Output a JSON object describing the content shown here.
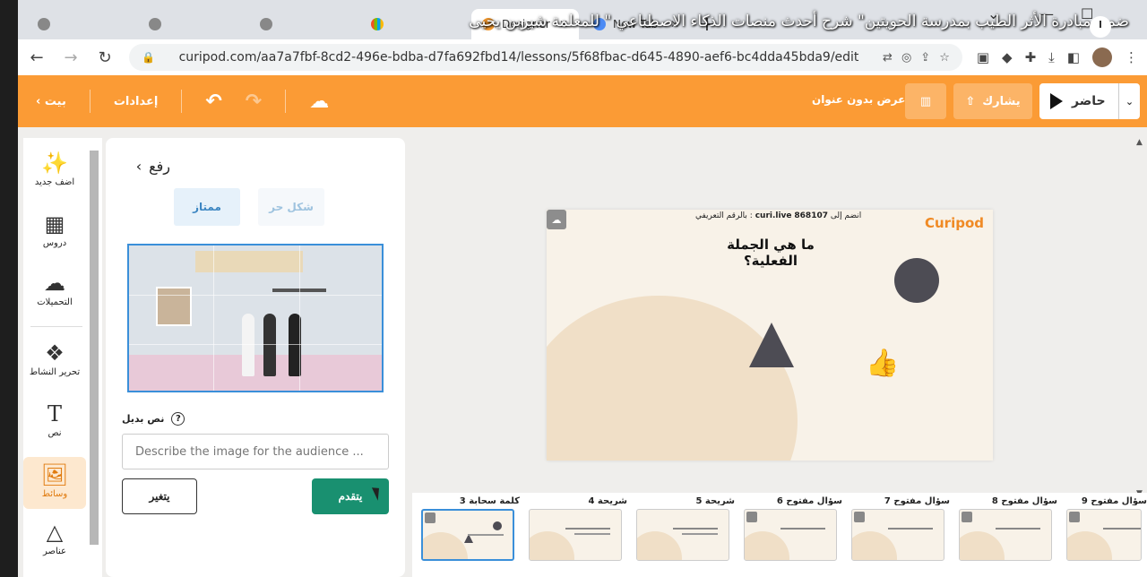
{
  "caption": "ضمن مبادرة الأثر الطيب بمدرسة الحويتين\" شرح أحدث منصات الذكاء الاصطناعي \" للمعلمة شيرين يحيى",
  "browser": {
    "tabs": [
      {
        "label": "",
        "icon": "tab-favicon"
      },
      {
        "label": "",
        "icon": "tab-favicon"
      },
      {
        "label": "",
        "icon": "tab-favicon"
      },
      {
        "label": "",
        "icon": "microsoft-icon"
      },
      {
        "label": "Designer",
        "icon": "curipod-icon",
        "active": true
      },
      {
        "label": "New Tab",
        "icon": "chrome-icon"
      }
    ],
    "url": "curipod.com/aa7a7fbf-8cd2-496e-bdba-d7fa692fbd14/lessons/5f68fbac-d645-4890-aef6-bc4dda45bda9/edit"
  },
  "header": {
    "back_label": "بيت",
    "settings_label": "إعدادات",
    "presentation_title": "عرض بدون عنوان",
    "share_label": "يشارك",
    "present_label": "حاضر"
  },
  "rail": [
    {
      "label": "اضف جديد",
      "icon": "magic-wand-icon"
    },
    {
      "label": "دروس",
      "icon": "grid-icon"
    },
    {
      "label": "التحميلات",
      "icon": "upload-cloud-icon"
    },
    {
      "label": "تحرير النشاط",
      "icon": "blocks-icon"
    },
    {
      "label": "نص",
      "icon": "text-icon"
    },
    {
      "label": "وسائط",
      "icon": "image-icon",
      "active": true
    },
    {
      "label": "عناصر",
      "icon": "shapes-icon"
    }
  ],
  "panel": {
    "back_label": "رفع",
    "tab_freeform": "شكل حر",
    "tab_excellent": "ممتاز",
    "alt_label": "نص بديل",
    "alt_placeholder": "Describe the image for the audience ...",
    "change_button": "يتغير",
    "apply_button": "يتقدم"
  },
  "slide": {
    "join_prefix": "انضم إلى",
    "join_site": "curi.live",
    "join_code": "868107",
    "join_suffix": ": بالرقم التعريفي",
    "logo": "Curipod",
    "question": "ما هي الجملة الفعلية؟",
    "thumb_emoji": "👍"
  },
  "filmstrip": [
    {
      "label": "كلمة سحابة 3",
      "selected": true
    },
    {
      "label": "شريحة 4"
    },
    {
      "label": "شريحة 5"
    },
    {
      "label": "سؤال مفتوح 6"
    },
    {
      "label": "سؤال مفتوح 7"
    },
    {
      "label": "سؤال مفتوح 8"
    },
    {
      "label": "سؤال مفتوح 9"
    }
  ],
  "colors": {
    "accent": "#fb9b35",
    "primary_button": "#199070",
    "selection": "#3a8fd9"
  }
}
